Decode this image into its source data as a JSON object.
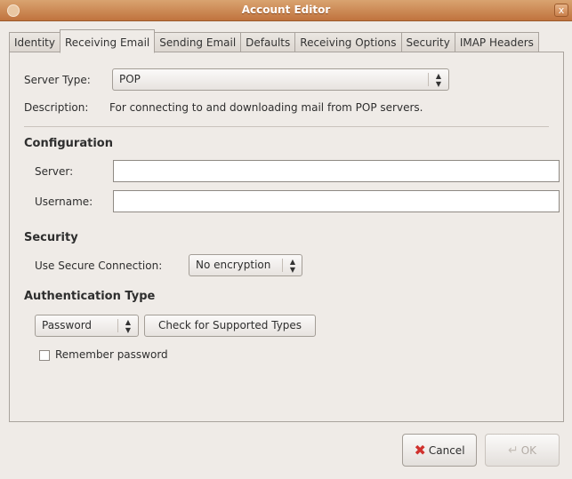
{
  "window": {
    "title": "Account Editor",
    "close_glyph": "x"
  },
  "tabs": [
    {
      "label": "Identity",
      "active": false
    },
    {
      "label": "Receiving Email",
      "active": true
    },
    {
      "label": "Sending Email",
      "active": false
    },
    {
      "label": "Defaults",
      "active": false
    },
    {
      "label": "Receiving Options",
      "active": false
    },
    {
      "label": "Security",
      "active": false
    },
    {
      "label": "IMAP Headers",
      "active": false
    }
  ],
  "server_type": {
    "label": "Server Type:",
    "value": "POP",
    "description_label": "Description:",
    "description": "For connecting to and downloading mail from POP servers."
  },
  "configuration": {
    "heading": "Configuration",
    "server_label": "Server:",
    "server_value": "",
    "username_label": "Username:",
    "username_value": ""
  },
  "security": {
    "heading": "Security",
    "secure_label": "Use Secure Connection:",
    "secure_value": "No encryption"
  },
  "auth": {
    "heading": "Authentication Type",
    "type_value": "Password",
    "check_button": "Check for Supported Types",
    "remember_label": "Remember password",
    "remember_checked": false
  },
  "dialog": {
    "cancel": "Cancel",
    "ok": "OK",
    "ok_enabled": false
  },
  "icons": {
    "window": "app-icon",
    "cancel": "cancel-x-icon",
    "ok": "ok-arrow-icon"
  }
}
